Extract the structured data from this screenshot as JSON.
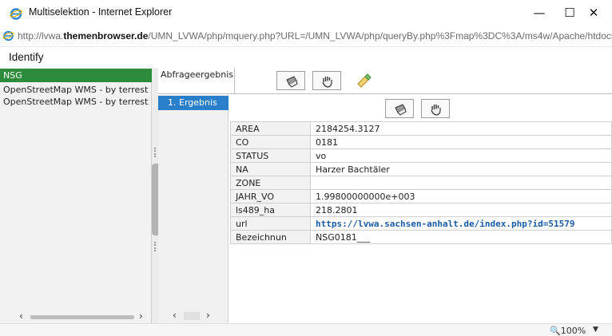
{
  "window": {
    "title": "Multiselektion - Internet Explorer",
    "minimize": "—",
    "maximize": "☐",
    "close": "✕"
  },
  "address": {
    "prefix": "http://lvwa.",
    "host": "themenbrowser.de",
    "path": "/UMN_LVWA/php/mquery.php?URL=/UMN_LVWA/php/queryBy.php%3Fmap%3DC%3A/ms4w/Apache/htdocs/UM"
  },
  "identify": {
    "title": "Identify"
  },
  "left": {
    "items": [
      "NSG",
      "OpenStreetMap WMS - by terrest",
      "OpenStreetMap WMS - by terrest"
    ]
  },
  "right": {
    "abfrage_label": "Abfrageergebnis",
    "tabs": [
      "1. Ergebnis"
    ],
    "rows": [
      {
        "key": "AREA",
        "value": "2184254.3127"
      },
      {
        "key": "CO",
        "value": "0181"
      },
      {
        "key": "STATUS",
        "value": "vo"
      },
      {
        "key": "NA",
        "value": "Harzer Bachtäler"
      },
      {
        "key": "ZONE",
        "value": ""
      },
      {
        "key": "JAHR_VO",
        "value": "1.99800000000e+003"
      },
      {
        "key": "ls489_ha",
        "value": "218.2801"
      },
      {
        "key": "url",
        "value": "https://lvwa.sachsen-anhalt.de/index.php?id=51579"
      },
      {
        "key": "Bezeichnun",
        "value": "NSG0181___"
      }
    ]
  },
  "status": {
    "zoom": "100%"
  },
  "colors": {
    "selected_green": "#2d8b3c",
    "tab_blue": "#2a7fcb",
    "link": "#1a5ba8"
  }
}
